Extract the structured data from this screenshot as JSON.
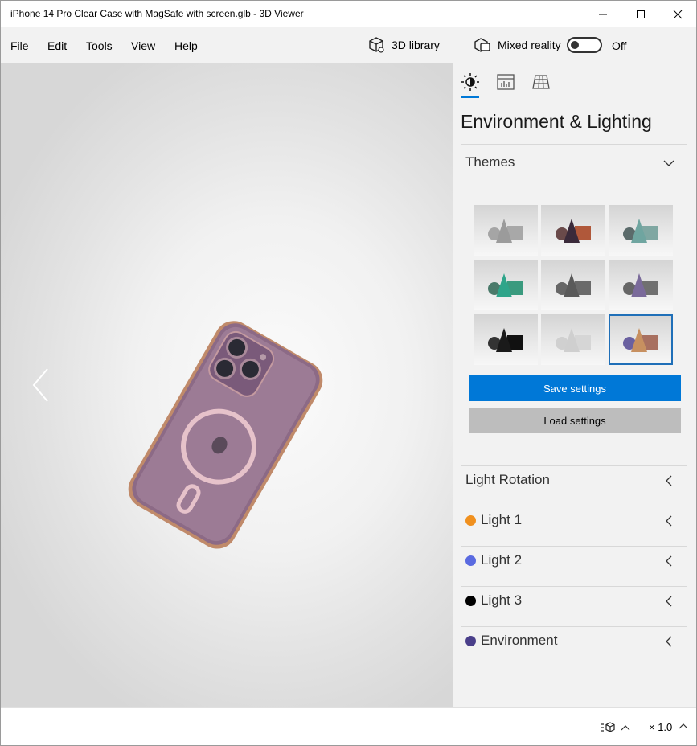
{
  "window": {
    "title": "iPhone 14 Pro Clear Case with MagSafe with screen.glb - 3D Viewer"
  },
  "menu": {
    "items": [
      "File",
      "Edit",
      "Tools",
      "View",
      "Help"
    ],
    "library_label": "3D library",
    "mixed_reality_label": "Mixed reality",
    "mixed_reality_state": "Off"
  },
  "panel": {
    "title": "Environment & Lighting",
    "themes_label": "Themes",
    "themes": [
      {
        "cone": "#9b9b9b",
        "ball": "#a5a5a5",
        "box": "#a8a8a8"
      },
      {
        "cone": "#3a2a3a",
        "ball": "#6a4a4a",
        "box": "#b0583a"
      },
      {
        "cone": "#6fa5a0",
        "ball": "#5b6b6b",
        "box": "#7fa7a2"
      },
      {
        "cone": "#2fa58a",
        "ball": "#4a7a6a",
        "box": "#3a9a7e"
      },
      {
        "cone": "#5a5a5a",
        "ball": "#666666",
        "box": "#6a6a6a"
      },
      {
        "cone": "#7a6a9a",
        "ball": "#666666",
        "box": "#707070"
      },
      {
        "cone": "#1a1a1a",
        "ball": "#333333",
        "box": "#111111"
      },
      {
        "cone": "#cfcfcf",
        "ball": "#d0d0d0",
        "box": "#d6d6d6"
      },
      {
        "cone": "#c79060",
        "ball": "#6a60a0",
        "box": "#a87060"
      }
    ],
    "selected_theme": 8,
    "save_label": "Save settings",
    "load_label": "Load settings",
    "sections": [
      {
        "label": "Light Rotation",
        "color": ""
      },
      {
        "label": "Light 1",
        "color": "#f0901e"
      },
      {
        "label": "Light 2",
        "color": "#5a6ae0"
      },
      {
        "label": "Light 3",
        "color": "#000000"
      },
      {
        "label": "Environment",
        "color": "#4a3f8a"
      }
    ]
  },
  "status": {
    "zoom": "× 1.0"
  }
}
